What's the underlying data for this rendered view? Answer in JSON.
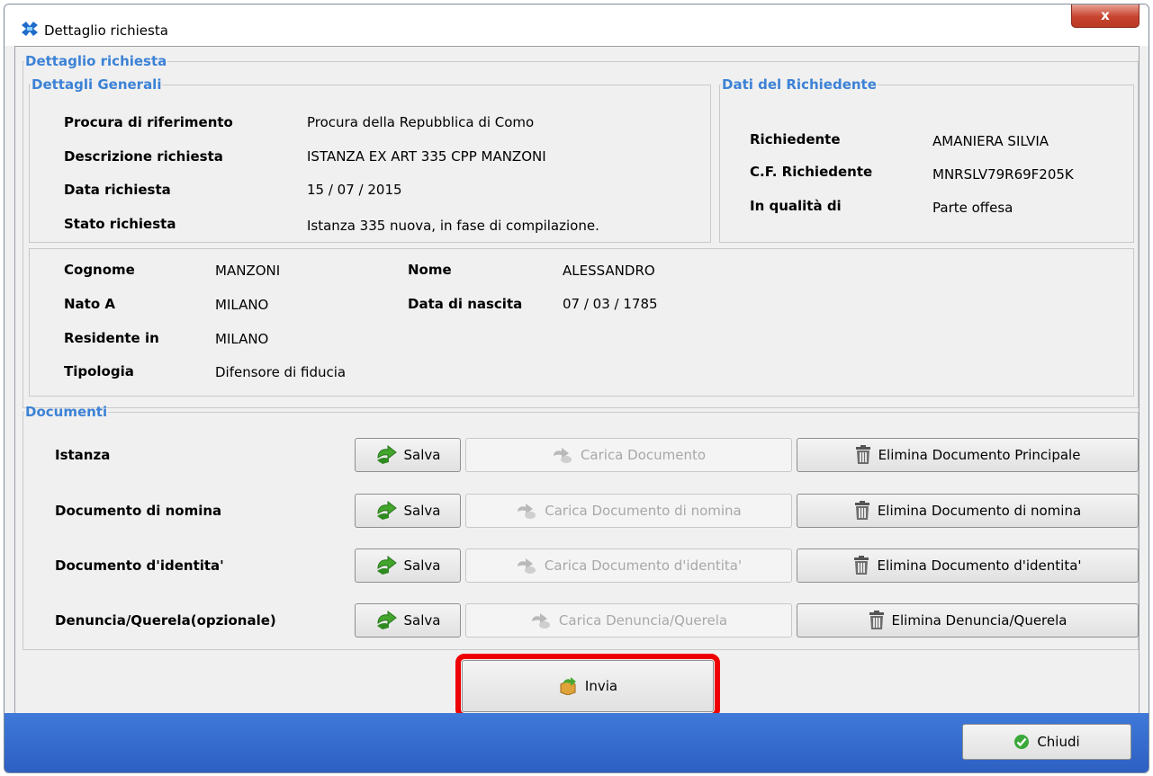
{
  "window": {
    "title": "Dettaglio richiesta",
    "close_label": "x"
  },
  "main_group": {
    "legend": "Dettaglio richiesta"
  },
  "general": {
    "legend": "Dettagli Generali",
    "rows": [
      {
        "label": "Procura di riferimento",
        "value": "Procura della Repubblica di Como"
      },
      {
        "label": "Descrizione richiesta",
        "value": "ISTANZA EX ART 335 CPP MANZONI"
      },
      {
        "label": "Data richiesta",
        "value": "15 / 07 / 2015"
      },
      {
        "label": "Stato richiesta",
        "value": "Istanza 335 nuova, in fase di compilazione."
      }
    ]
  },
  "requester": {
    "legend": "Dati del Richiedente",
    "rows": [
      {
        "label": "Richiedente",
        "value": "AMANIERA SILVIA"
      },
      {
        "label": "C.F. Richiedente",
        "value": "MNRSLV79R69F205K"
      },
      {
        "label": "In qualità di",
        "value": "Parte offesa"
      }
    ]
  },
  "person": {
    "cognome_label": "Cognome",
    "cognome": "MANZONI",
    "nome_label": "Nome",
    "nome": "ALESSANDRO",
    "nato_label": "Nato A",
    "nato": "MILANO",
    "nascita_label": "Data di nascita",
    "nascita": "07 / 03 / 1785",
    "residente_label": "Residente in",
    "residente": "MILANO",
    "tipologia_label": "Tipologia",
    "tipologia": "Difensore di fiducia"
  },
  "documents": {
    "legend": "Documenti",
    "rows": [
      {
        "label": "Istanza",
        "save": "Salva",
        "load": "Carica Documento",
        "delete": "Elimina Documento Principale"
      },
      {
        "label": "Documento di nomina",
        "save": "Salva",
        "load": "Carica Documento di nomina",
        "delete": "Elimina Documento di nomina"
      },
      {
        "label": "Documento d'identita'",
        "save": "Salva",
        "load": "Carica Documento d'identita'",
        "delete": "Elimina Documento d'identita'"
      },
      {
        "label": "Denuncia/Querela(opzionale)",
        "save": "Salva",
        "load": "Carica Denuncia/Querela",
        "delete": "Elimina Denuncia/Querela"
      }
    ]
  },
  "actions": {
    "send": "Invia",
    "close": "Chiudi"
  },
  "icons": {
    "app": "app-logo-icon",
    "save": "green-arrow-icon",
    "load": "upload-icon",
    "delete": "trash-icon",
    "send": "send-package-icon",
    "close": "green-check-icon"
  },
  "colors": {
    "legend": "#3c82d6",
    "statusbar": "#2c5fc1",
    "highlight": "#ee0000",
    "close_button": "#c7432e"
  }
}
